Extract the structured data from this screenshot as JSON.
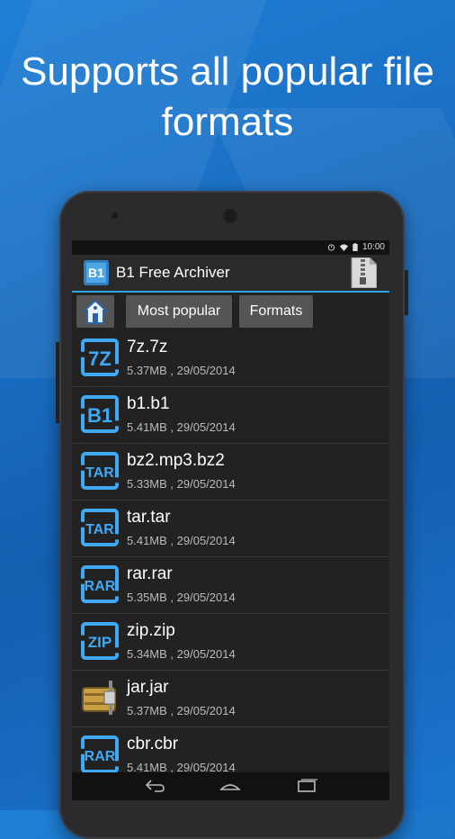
{
  "headline": "Supports all popular file formats",
  "status": {
    "time": "10:00"
  },
  "app": {
    "title": "B1 Free Archiver",
    "logo_text": "B1"
  },
  "toolbar": {
    "popular_label": "Most popular",
    "formats_label": "Formats"
  },
  "files": [
    {
      "name": "7z.7z",
      "meta": "5.37MB , 29/05/2014",
      "icon": "7Z"
    },
    {
      "name": "b1.b1",
      "meta": "5.41MB , 29/05/2014",
      "icon": "B1"
    },
    {
      "name": "bz2.mp3.bz2",
      "meta": "5.33MB , 29/05/2014",
      "icon": "TAR"
    },
    {
      "name": "tar.tar",
      "meta": "5.41MB , 29/05/2014",
      "icon": "TAR"
    },
    {
      "name": "rar.rar",
      "meta": "5.35MB , 29/05/2014",
      "icon": "RAR"
    },
    {
      "name": "zip.zip",
      "meta": "5.34MB , 29/05/2014",
      "icon": "ZIP"
    },
    {
      "name": "jar.jar",
      "meta": "5.37MB , 29/05/2014",
      "icon": "jar-archive-icon"
    },
    {
      "name": "cbr.cbr",
      "meta": "5.41MB , 29/05/2014",
      "icon": "RAR"
    }
  ],
  "colors": {
    "accent": "#29a6e0",
    "icon_blue": "#3fa9f5",
    "background": "#1a6fc4"
  }
}
